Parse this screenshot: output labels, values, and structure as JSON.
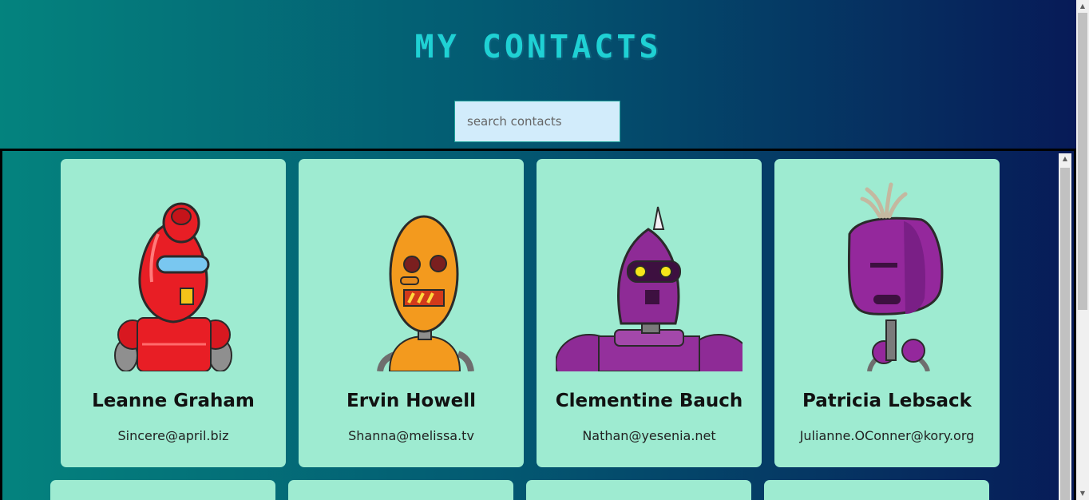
{
  "header": {
    "title": "MY CONTACTS"
  },
  "search": {
    "placeholder": "search contacts",
    "value": ""
  },
  "contacts": [
    {
      "name": "Leanne Graham",
      "email": "Sincere@april.biz",
      "robot_color": "#e0181f"
    },
    {
      "name": "Ervin Howell",
      "email": "Shanna@melissa.tv",
      "robot_color": "#f39a1e"
    },
    {
      "name": "Clementine Bauch",
      "email": "Nathan@yesenia.net",
      "robot_color": "#8e2b96"
    },
    {
      "name": "Patricia Lebsack",
      "email": "Julianne.OConner@kory.org",
      "robot_color": "#94289c"
    }
  ]
}
